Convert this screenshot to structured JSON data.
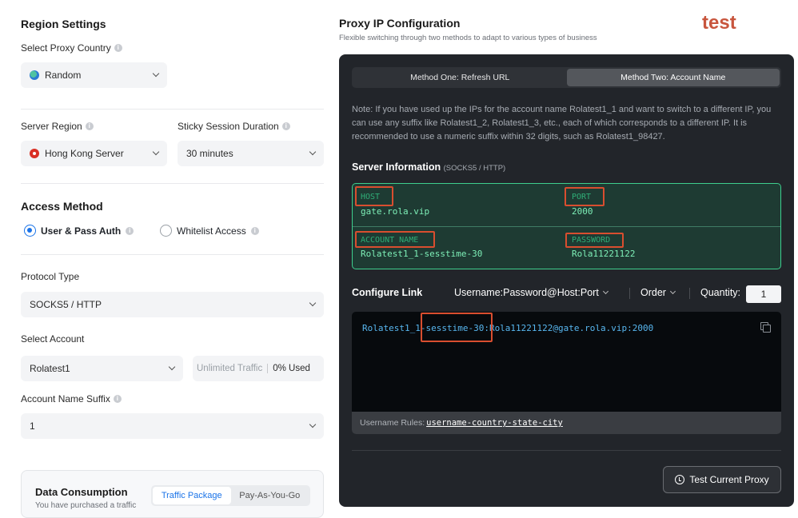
{
  "left": {
    "region_title": "Region Settings",
    "proxy_country_label": "Select Proxy Country",
    "proxy_country_value": "Random",
    "server_region_label": "Server Region",
    "server_region_value": "Hong Kong Server",
    "sticky_label": "Sticky Session Duration",
    "sticky_value": "30 minutes",
    "access_title": "Access Method",
    "access_options": [
      "User & Pass Auth",
      "Whitelist Access"
    ],
    "access_selected": "User & Pass Auth",
    "protocol_label": "Protocol Type",
    "protocol_value": "SOCKS5 / HTTP",
    "account_label": "Select Account",
    "account_value": "Rolatest1",
    "traffic_unlimited": "Unlimited Traffic",
    "traffic_used": "0% Used",
    "suffix_label": "Account Name Suffix",
    "suffix_value": "1",
    "consumption_title": "Data Consumption",
    "consumption_sub": "You have purchased a traffic",
    "consumption_tabs": [
      "Traffic Package",
      "Pay-As-You-Go"
    ],
    "consumption_active": "Traffic Package"
  },
  "right": {
    "title": "Proxy IP Configuration",
    "subtitle": "Flexible switching through two methods to adapt to various types of business",
    "brand": "test",
    "tabs": [
      "Method One: Refresh URL",
      "Method Two: Account Name"
    ],
    "active_tab": "Method Two: Account Name",
    "note": "Note: If you have used up the IPs for the account name Rolatest1_1 and want to switch to a different IP, you can use any suffix like Rolatest1_2, Rolatest1_3, etc., each of which corresponds to a different IP. It is recommended to use a numeric suffix within 32 digits, such as Rolatest1_98427.",
    "server_title": "Server Information",
    "server_sub": "(SOCKS5 / HTTP)",
    "host_key": "HOST",
    "host_value": "gate.rola.vip",
    "port_key": "PORT",
    "port_value": "2000",
    "account_key": "ACCOUNT NAME",
    "account_value": "Rolatest1_1-sesstime-30",
    "password_key": "PASSWORD",
    "password_value": "Rola11221122",
    "configure_title": "Configure Link",
    "format_value": "Username:Password@Host:Port",
    "order_label": "Order",
    "quantity_label": "Quantity:",
    "quantity_value": "1",
    "link_value": "Rolatest1_1-sesstime-30:Rola11221122@gate.rola.vip:2000",
    "rules_label": "Username Rules:",
    "rules_value": "username-country-state-city",
    "test_button": "Test Current Proxy"
  },
  "colors": {
    "accent": "#1a73e8",
    "panel_dark": "#22252a",
    "server_border": "#3ecf8e",
    "highlight": "#d94e2f",
    "brand": "#c8553d",
    "link": "#58b7f0"
  }
}
